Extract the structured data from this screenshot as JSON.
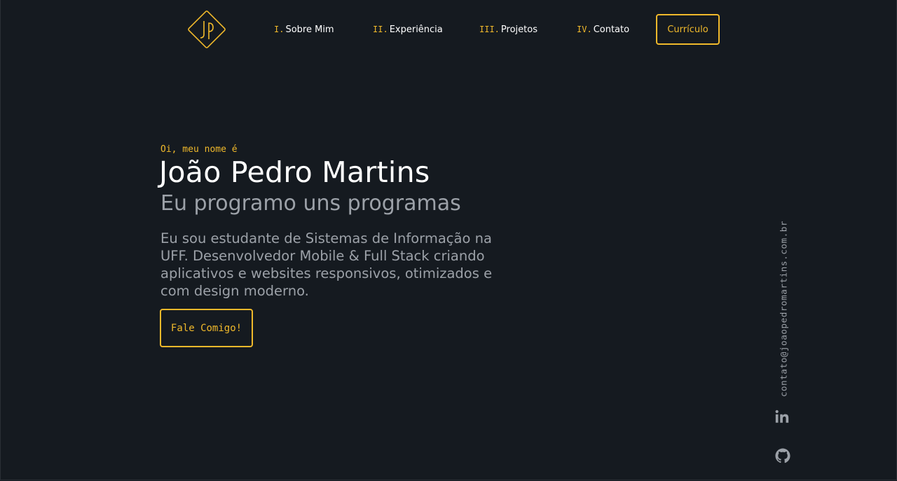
{
  "nav": {
    "items": [
      {
        "num": "I.",
        "label": "Sobre Mim"
      },
      {
        "num": "II.",
        "label": "Experiência"
      },
      {
        "num": "III.",
        "label": "Projetos"
      },
      {
        "num": "IV.",
        "label": "Contato"
      }
    ],
    "resume_label": "Currículo"
  },
  "hero": {
    "greeting": "Oi, meu nome é",
    "name": "João Pedro Martins",
    "tagline": "Eu programo uns programas",
    "description": "Eu sou estudante de Sistemas de Informação na UFF. Desenvolvedor Mobile & Full Stack criando aplicativos e websites responsivos, otimizados e com design moderno.",
    "cta_label": "Fale Comigo!"
  },
  "side": {
    "email": "contato@joaopedromartins.com.br",
    "icons": [
      "linkedin-icon",
      "github-icon"
    ]
  },
  "colors": {
    "background": "#151a20",
    "accent": "#f0b92b",
    "muted_text": "#9ca1a8",
    "text": "#ffffff"
  }
}
